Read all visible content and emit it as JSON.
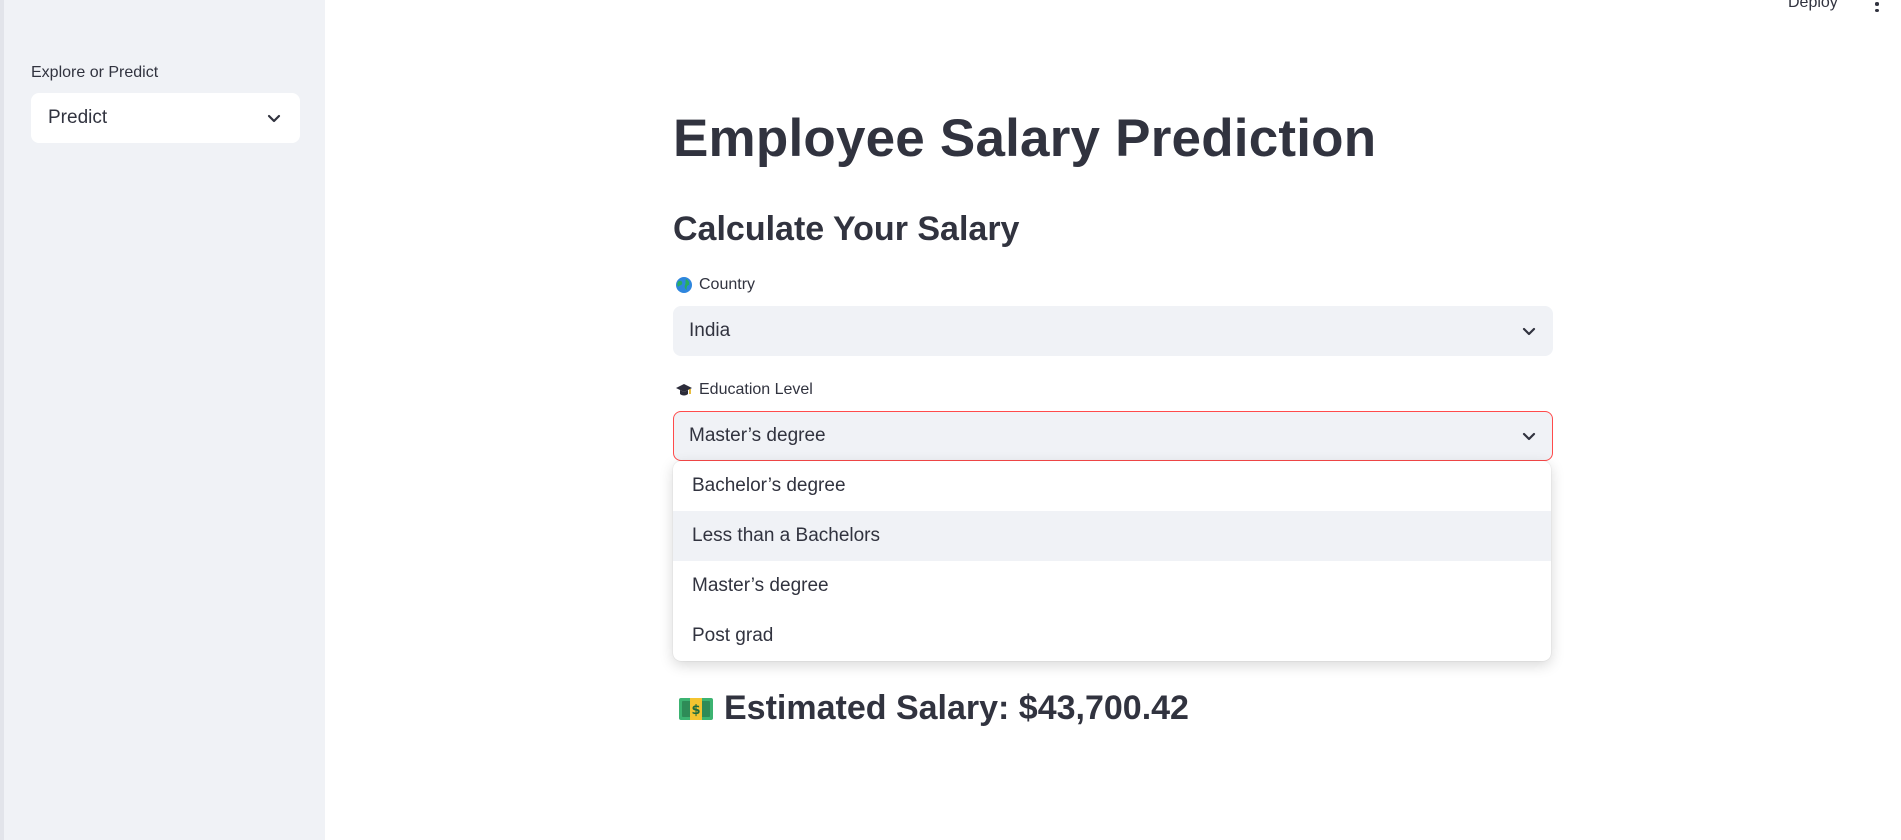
{
  "header": {
    "deploy_label": "Deploy",
    "menu_icon": "kebab-menu-icon"
  },
  "sidebar": {
    "label": "Explore or Predict",
    "selected": "Predict"
  },
  "main": {
    "title": "Employee Salary Prediction",
    "subtitle": "Calculate Your Salary",
    "country": {
      "icon": "globe-icon",
      "label": "Country",
      "value": "India"
    },
    "education": {
      "icon": "graduation-cap-icon",
      "label": "Education Level",
      "value": "Master’s degree",
      "options": [
        "Bachelor’s degree",
        "Less than a Bachelors",
        "Master’s degree",
        "Post grad"
      ]
    },
    "result": {
      "icon": "money-icon",
      "text": "Estimated Salary: $43,700.42"
    }
  },
  "colors": {
    "sidebar_bg": "#f0f2f6",
    "text": "#31333f",
    "focus_border": "#ff4b4b",
    "money_green": "#3cb371"
  }
}
